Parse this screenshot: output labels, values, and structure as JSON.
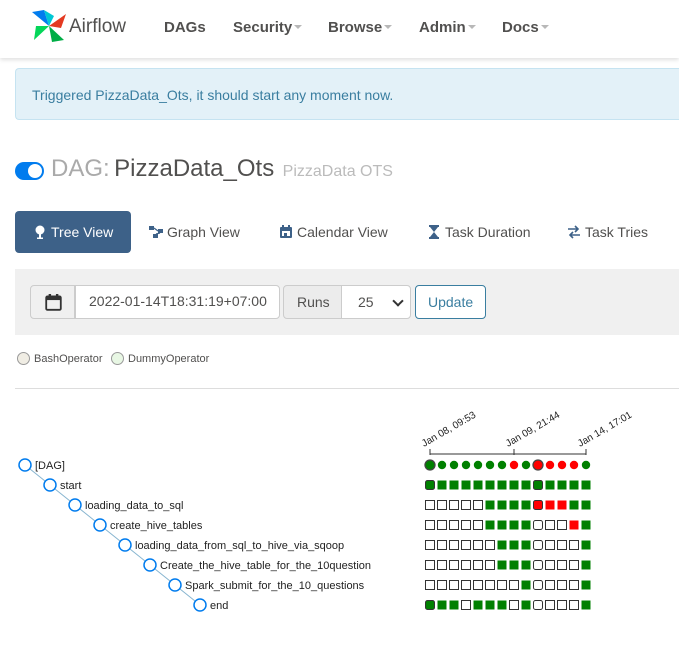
{
  "navbar": {
    "brand": "Airflow",
    "items": [
      {
        "label": "DAGs",
        "caret": false
      },
      {
        "label": "Security",
        "caret": true
      },
      {
        "label": "Browse",
        "caret": true
      },
      {
        "label": "Admin",
        "caret": true
      },
      {
        "label": "Docs",
        "caret": true
      }
    ]
  },
  "alert": {
    "message": "Triggered PizzaData_Ots, it should start any moment now."
  },
  "dag": {
    "prefix": "DAG:",
    "id": "PizzaData_Ots",
    "description": "PizzaData OTS",
    "paused": false
  },
  "tabs": [
    "Tree View",
    "Graph View",
    "Calendar View",
    "Task Duration",
    "Task Tries"
  ],
  "controls": {
    "base_date": "2022-01-14T18:31:19+07:00",
    "runs_label": "Runs",
    "runs_value": "25",
    "update_label": "Update"
  },
  "legend": [
    {
      "label": "BashOperator",
      "color": "#f0ede4"
    },
    {
      "label": "DummyOperator",
      "color": "#e8f7e4"
    }
  ],
  "colors": {
    "success": "#008000",
    "failed": "#ff0000",
    "upstream_failed": "#ffa500",
    "none": "#ffffff",
    "running": "#00ff00"
  },
  "tree": {
    "dates": [
      "Jan 08, 09:53",
      "Jan 09, 21:44",
      "Jan 14, 17:01"
    ],
    "tasks": [
      {
        "label": "[DAG]",
        "states": [
          "dsuccess",
          "success",
          "success",
          "success",
          "success",
          "success",
          "success",
          "failed",
          "success",
          "dfailed",
          "failed",
          "failed",
          "failed",
          "success"
        ]
      },
      {
        "label": "start",
        "states": [
          "dsuccess",
          "success",
          "success",
          "success",
          "success",
          "success",
          "success",
          "success",
          "success",
          "dsuccess",
          "success",
          "success",
          "success",
          "success"
        ]
      },
      {
        "label": "loading_data_to_sql",
        "states": [
          "none",
          "none",
          "none",
          "none",
          "none",
          "success",
          "success",
          "success",
          "success",
          "dfailed",
          "failed",
          "failed",
          "success",
          "success"
        ]
      },
      {
        "label": "create_hive_tables",
        "states": [
          "none",
          "none",
          "none",
          "none",
          "none",
          "success",
          "success",
          "success",
          "success",
          "dupstream",
          "upstream",
          "upstream",
          "failed",
          "success"
        ]
      },
      {
        "label": "loading_data_from_sql_to_hive_via_sqoop",
        "states": [
          "none",
          "none",
          "none",
          "none",
          "none",
          "none",
          "success",
          "success",
          "success",
          "dupstream",
          "upstream",
          "upstream",
          "upstream",
          "success"
        ]
      },
      {
        "label": "Create_the_hive_table_for_the_10question",
        "states": [
          "none",
          "none",
          "none",
          "none",
          "none",
          "none",
          "success",
          "success",
          "success",
          "dupstream",
          "upstream",
          "upstream",
          "upstream",
          "success"
        ]
      },
      {
        "label": "Spark_submit_for_the_10_questions",
        "states": [
          "none",
          "none",
          "none",
          "none",
          "none",
          "none",
          "none",
          "upstream",
          "success",
          "dupstream",
          "upstream",
          "upstream",
          "upstream",
          "success"
        ]
      },
      {
        "label": "end",
        "states": [
          "dsuccess",
          "success",
          "success",
          "none",
          "success",
          "success",
          "success",
          "upstream",
          "success",
          "dupstream",
          "upstream",
          "upstream",
          "upstream",
          "success"
        ]
      }
    ]
  }
}
